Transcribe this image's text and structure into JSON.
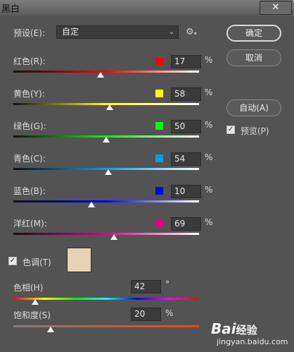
{
  "window": {
    "title": "黑白",
    "close_glyph": "✕"
  },
  "preset": {
    "label": "预设(E):",
    "value": "自定",
    "menu_icon": "gear-icon"
  },
  "buttons": {
    "ok": "确定",
    "cancel": "取消",
    "auto": "自动(A)"
  },
  "preview": {
    "label": "预览(P)",
    "checked": true
  },
  "sliders": [
    {
      "label": "红色(R):",
      "value": "17",
      "unit": "%",
      "swatch": "#ff0000",
      "fraction": 0.47
    },
    {
      "label": "黄色(Y):",
      "value": "58",
      "unit": "%",
      "swatch": "#ffff00",
      "fraction": 0.52
    },
    {
      "label": "绿色(G):",
      "value": "50",
      "unit": "%",
      "swatch": "#00ff00",
      "fraction": 0.5
    },
    {
      "label": "青色(C):",
      "value": "54",
      "unit": "%",
      "swatch": "#00a0e9",
      "fraction": 0.51
    },
    {
      "label": "蓝色(B):",
      "value": "10",
      "unit": "%",
      "swatch": "#0000ff",
      "fraction": 0.42
    },
    {
      "label": "洋红(M):",
      "value": "69",
      "unit": "%",
      "swatch": "#e4007f",
      "fraction": 0.54
    }
  ],
  "tint": {
    "label": "色调(T)",
    "checked": true,
    "color": "#e5d3b1",
    "hue": {
      "label": "色相(H)",
      "value": "42",
      "unit": "°",
      "fraction": 0.117
    },
    "saturation": {
      "label": "饱和度(S)",
      "value": "20",
      "unit": "%",
      "fraction": 0.2
    }
  },
  "watermark": {
    "brand_a": "Bai",
    "brand_b": "经验",
    "url": "jingyan.baidu.com"
  }
}
